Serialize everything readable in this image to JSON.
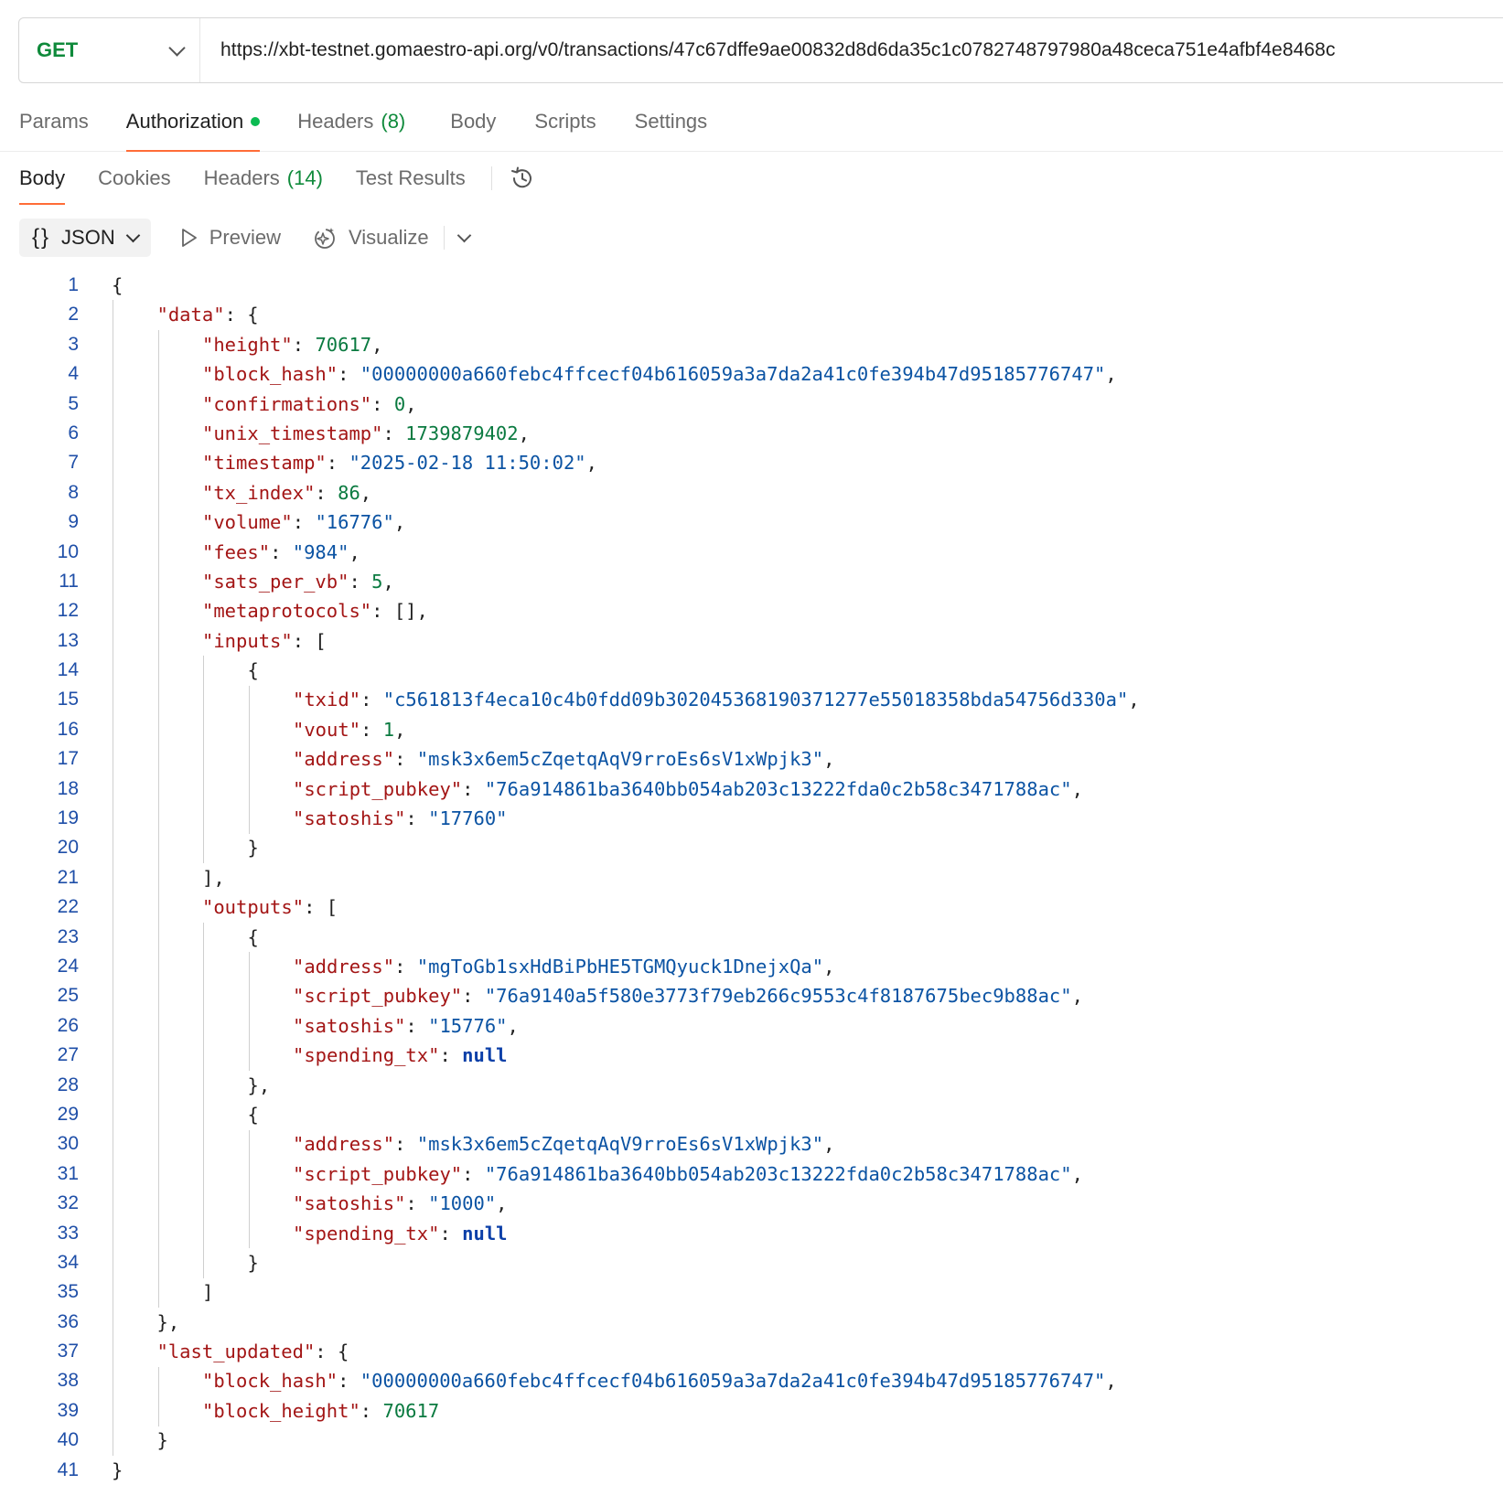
{
  "request": {
    "method": "GET",
    "url": "https://xbt-testnet.gomaestro-api.org/v0/transactions/47c67dffe9ae00832d8d6da35c1c0782748797980a48ceca751e4afbf4e8468c"
  },
  "request_tabs": {
    "params": "Params",
    "authorization": "Authorization",
    "headers": "Headers",
    "headers_count": "(8)",
    "body": "Body",
    "scripts": "Scripts",
    "settings": "Settings"
  },
  "response_tabs": {
    "body": "Body",
    "cookies": "Cookies",
    "headers": "Headers",
    "headers_count": "(14)",
    "test_results": "Test Results"
  },
  "format_bar": {
    "format_icon": "{}",
    "format": "JSON",
    "preview": "Preview",
    "visualize": "Visualize"
  },
  "icons": {
    "history": "history-icon",
    "preview": "play-icon",
    "visualize": "sparkle-icon"
  },
  "colors": {
    "accent": "#ff6c37",
    "method": "#0f8a3b",
    "json_key": "#a31515",
    "json_string": "#0b53a3",
    "json_number": "#0a7a40",
    "status_dot": "#0cbb52"
  },
  "code_lines": [
    [
      {
        "t": "p",
        "v": "{"
      }
    ],
    [
      {
        "t": "k",
        "v": "\"data\""
      },
      {
        "t": "p",
        "v": ": {"
      }
    ],
    [
      {
        "t": "k",
        "v": "\"height\""
      },
      {
        "t": "p",
        "v": ": "
      },
      {
        "t": "n",
        "v": "70617"
      },
      {
        "t": "p",
        "v": ","
      }
    ],
    [
      {
        "t": "k",
        "v": "\"block_hash\""
      },
      {
        "t": "p",
        "v": ": "
      },
      {
        "t": "s",
        "v": "\"00000000a660febc4ffcecf04b616059a3a7da2a41c0fe394b47d95185776747\""
      },
      {
        "t": "p",
        "v": ","
      }
    ],
    [
      {
        "t": "k",
        "v": "\"confirmations\""
      },
      {
        "t": "p",
        "v": ": "
      },
      {
        "t": "n",
        "v": "0"
      },
      {
        "t": "p",
        "v": ","
      }
    ],
    [
      {
        "t": "k",
        "v": "\"unix_timestamp\""
      },
      {
        "t": "p",
        "v": ": "
      },
      {
        "t": "n",
        "v": "1739879402"
      },
      {
        "t": "p",
        "v": ","
      }
    ],
    [
      {
        "t": "k",
        "v": "\"timestamp\""
      },
      {
        "t": "p",
        "v": ": "
      },
      {
        "t": "s",
        "v": "\"2025-02-18 11:50:02\""
      },
      {
        "t": "p",
        "v": ","
      }
    ],
    [
      {
        "t": "k",
        "v": "\"tx_index\""
      },
      {
        "t": "p",
        "v": ": "
      },
      {
        "t": "n",
        "v": "86"
      },
      {
        "t": "p",
        "v": ","
      }
    ],
    [
      {
        "t": "k",
        "v": "\"volume\""
      },
      {
        "t": "p",
        "v": ": "
      },
      {
        "t": "s",
        "v": "\"16776\""
      },
      {
        "t": "p",
        "v": ","
      }
    ],
    [
      {
        "t": "k",
        "v": "\"fees\""
      },
      {
        "t": "p",
        "v": ": "
      },
      {
        "t": "s",
        "v": "\"984\""
      },
      {
        "t": "p",
        "v": ","
      }
    ],
    [
      {
        "t": "k",
        "v": "\"sats_per_vb\""
      },
      {
        "t": "p",
        "v": ": "
      },
      {
        "t": "n",
        "v": "5"
      },
      {
        "t": "p",
        "v": ","
      }
    ],
    [
      {
        "t": "k",
        "v": "\"metaprotocols\""
      },
      {
        "t": "p",
        "v": ": [],"
      }
    ],
    [
      {
        "t": "k",
        "v": "\"inputs\""
      },
      {
        "t": "p",
        "v": ": ["
      }
    ],
    [
      {
        "t": "p",
        "v": "{"
      }
    ],
    [
      {
        "t": "k",
        "v": "\"txid\""
      },
      {
        "t": "p",
        "v": ": "
      },
      {
        "t": "s",
        "v": "\"c561813f4eca10c4b0fdd09b302045368190371277e55018358bda54756d330a\""
      },
      {
        "t": "p",
        "v": ","
      }
    ],
    [
      {
        "t": "k",
        "v": "\"vout\""
      },
      {
        "t": "p",
        "v": ": "
      },
      {
        "t": "n",
        "v": "1"
      },
      {
        "t": "p",
        "v": ","
      }
    ],
    [
      {
        "t": "k",
        "v": "\"address\""
      },
      {
        "t": "p",
        "v": ": "
      },
      {
        "t": "s",
        "v": "\"msk3x6em5cZqetqAqV9rroEs6sV1xWpjk3\""
      },
      {
        "t": "p",
        "v": ","
      }
    ],
    [
      {
        "t": "k",
        "v": "\"script_pubkey\""
      },
      {
        "t": "p",
        "v": ": "
      },
      {
        "t": "s",
        "v": "\"76a914861ba3640bb054ab203c13222fda0c2b58c3471788ac\""
      },
      {
        "t": "p",
        "v": ","
      }
    ],
    [
      {
        "t": "k",
        "v": "\"satoshis\""
      },
      {
        "t": "p",
        "v": ": "
      },
      {
        "t": "s",
        "v": "\"17760\""
      }
    ],
    [
      {
        "t": "p",
        "v": "}"
      }
    ],
    [
      {
        "t": "p",
        "v": "],"
      }
    ],
    [
      {
        "t": "k",
        "v": "\"outputs\""
      },
      {
        "t": "p",
        "v": ": ["
      }
    ],
    [
      {
        "t": "p",
        "v": "{"
      }
    ],
    [
      {
        "t": "k",
        "v": "\"address\""
      },
      {
        "t": "p",
        "v": ": "
      },
      {
        "t": "s",
        "v": "\"mgToGb1sxHdBiPbHE5TGMQyuck1DnejxQa\""
      },
      {
        "t": "p",
        "v": ","
      }
    ],
    [
      {
        "t": "k",
        "v": "\"script_pubkey\""
      },
      {
        "t": "p",
        "v": ": "
      },
      {
        "t": "s",
        "v": "\"76a9140a5f580e3773f79eb266c9553c4f8187675bec9b88ac\""
      },
      {
        "t": "p",
        "v": ","
      }
    ],
    [
      {
        "t": "k",
        "v": "\"satoshis\""
      },
      {
        "t": "p",
        "v": ": "
      },
      {
        "t": "s",
        "v": "\"15776\""
      },
      {
        "t": "p",
        "v": ","
      }
    ],
    [
      {
        "t": "k",
        "v": "\"spending_tx\""
      },
      {
        "t": "p",
        "v": ": "
      },
      {
        "t": "kw",
        "v": "null"
      }
    ],
    [
      {
        "t": "p",
        "v": "},"
      }
    ],
    [
      {
        "t": "p",
        "v": "{"
      }
    ],
    [
      {
        "t": "k",
        "v": "\"address\""
      },
      {
        "t": "p",
        "v": ": "
      },
      {
        "t": "s",
        "v": "\"msk3x6em5cZqetqAqV9rroEs6sV1xWpjk3\""
      },
      {
        "t": "p",
        "v": ","
      }
    ],
    [
      {
        "t": "k",
        "v": "\"script_pubkey\""
      },
      {
        "t": "p",
        "v": ": "
      },
      {
        "t": "s",
        "v": "\"76a914861ba3640bb054ab203c13222fda0c2b58c3471788ac\""
      },
      {
        "t": "p",
        "v": ","
      }
    ],
    [
      {
        "t": "k",
        "v": "\"satoshis\""
      },
      {
        "t": "p",
        "v": ": "
      },
      {
        "t": "s",
        "v": "\"1000\""
      },
      {
        "t": "p",
        "v": ","
      }
    ],
    [
      {
        "t": "k",
        "v": "\"spending_tx\""
      },
      {
        "t": "p",
        "v": ": "
      },
      {
        "t": "kw",
        "v": "null"
      }
    ],
    [
      {
        "t": "p",
        "v": "}"
      }
    ],
    [
      {
        "t": "p",
        "v": "]"
      }
    ],
    [
      {
        "t": "p",
        "v": "},"
      }
    ],
    [
      {
        "t": "k",
        "v": "\"last_updated\""
      },
      {
        "t": "p",
        "v": ": {"
      }
    ],
    [
      {
        "t": "k",
        "v": "\"block_hash\""
      },
      {
        "t": "p",
        "v": ": "
      },
      {
        "t": "s",
        "v": "\"00000000a660febc4ffcecf04b616059a3a7da2a41c0fe394b47d95185776747\""
      },
      {
        "t": "p",
        "v": ","
      }
    ],
    [
      {
        "t": "k",
        "v": "\"block_height\""
      },
      {
        "t": "p",
        "v": ": "
      },
      {
        "t": "n",
        "v": "70617"
      }
    ],
    [
      {
        "t": "p",
        "v": "}"
      }
    ],
    [
      {
        "t": "p",
        "v": "}"
      }
    ]
  ]
}
